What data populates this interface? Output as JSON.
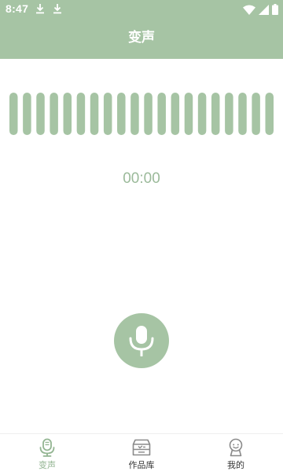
{
  "status_bar": {
    "time": "8:47",
    "icons": [
      "download-icon",
      "download-icon",
      "wifi-icon",
      "signal-icon",
      "battery-icon"
    ]
  },
  "header": {
    "title": "变声"
  },
  "recorder": {
    "timer": "00:00",
    "wave_bar_count": 20,
    "mic_icon": "microphone-icon"
  },
  "tabs": [
    {
      "label": "变声",
      "icon": "microphone-icon",
      "active": true
    },
    {
      "label": "作品库",
      "icon": "archive-box-icon",
      "active": false
    },
    {
      "label": "我的",
      "icon": "profile-icon",
      "active": false
    }
  ],
  "colors": {
    "accent": "#a6c4a4",
    "accent_text": "#93b592",
    "timer_text": "#9bba9a",
    "inactive_text": "#333333",
    "inactive_icon": "#8a8a8a"
  }
}
